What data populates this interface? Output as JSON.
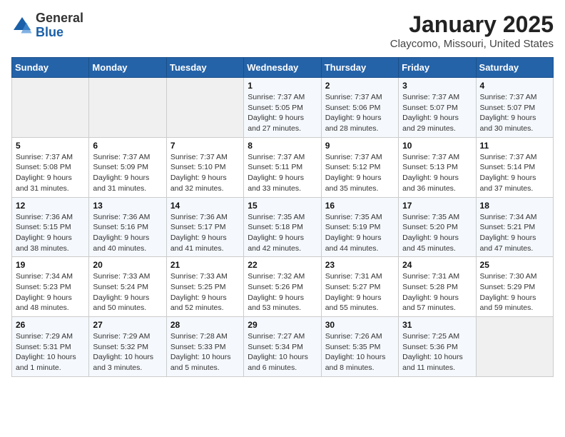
{
  "header": {
    "logo_general": "General",
    "logo_blue": "Blue",
    "title": "January 2025",
    "subtitle": "Claycomo, Missouri, United States"
  },
  "weekdays": [
    "Sunday",
    "Monday",
    "Tuesday",
    "Wednesday",
    "Thursday",
    "Friday",
    "Saturday"
  ],
  "weeks": [
    [
      {
        "day": "",
        "info": ""
      },
      {
        "day": "",
        "info": ""
      },
      {
        "day": "",
        "info": ""
      },
      {
        "day": "1",
        "info": "Sunrise: 7:37 AM\nSunset: 5:05 PM\nDaylight: 9 hours and 27 minutes."
      },
      {
        "day": "2",
        "info": "Sunrise: 7:37 AM\nSunset: 5:06 PM\nDaylight: 9 hours and 28 minutes."
      },
      {
        "day": "3",
        "info": "Sunrise: 7:37 AM\nSunset: 5:07 PM\nDaylight: 9 hours and 29 minutes."
      },
      {
        "day": "4",
        "info": "Sunrise: 7:37 AM\nSunset: 5:07 PM\nDaylight: 9 hours and 30 minutes."
      }
    ],
    [
      {
        "day": "5",
        "info": "Sunrise: 7:37 AM\nSunset: 5:08 PM\nDaylight: 9 hours and 31 minutes."
      },
      {
        "day": "6",
        "info": "Sunrise: 7:37 AM\nSunset: 5:09 PM\nDaylight: 9 hours and 31 minutes."
      },
      {
        "day": "7",
        "info": "Sunrise: 7:37 AM\nSunset: 5:10 PM\nDaylight: 9 hours and 32 minutes."
      },
      {
        "day": "8",
        "info": "Sunrise: 7:37 AM\nSunset: 5:11 PM\nDaylight: 9 hours and 33 minutes."
      },
      {
        "day": "9",
        "info": "Sunrise: 7:37 AM\nSunset: 5:12 PM\nDaylight: 9 hours and 35 minutes."
      },
      {
        "day": "10",
        "info": "Sunrise: 7:37 AM\nSunset: 5:13 PM\nDaylight: 9 hours and 36 minutes."
      },
      {
        "day": "11",
        "info": "Sunrise: 7:37 AM\nSunset: 5:14 PM\nDaylight: 9 hours and 37 minutes."
      }
    ],
    [
      {
        "day": "12",
        "info": "Sunrise: 7:36 AM\nSunset: 5:15 PM\nDaylight: 9 hours and 38 minutes."
      },
      {
        "day": "13",
        "info": "Sunrise: 7:36 AM\nSunset: 5:16 PM\nDaylight: 9 hours and 40 minutes."
      },
      {
        "day": "14",
        "info": "Sunrise: 7:36 AM\nSunset: 5:17 PM\nDaylight: 9 hours and 41 minutes."
      },
      {
        "day": "15",
        "info": "Sunrise: 7:35 AM\nSunset: 5:18 PM\nDaylight: 9 hours and 42 minutes."
      },
      {
        "day": "16",
        "info": "Sunrise: 7:35 AM\nSunset: 5:19 PM\nDaylight: 9 hours and 44 minutes."
      },
      {
        "day": "17",
        "info": "Sunrise: 7:35 AM\nSunset: 5:20 PM\nDaylight: 9 hours and 45 minutes."
      },
      {
        "day": "18",
        "info": "Sunrise: 7:34 AM\nSunset: 5:21 PM\nDaylight: 9 hours and 47 minutes."
      }
    ],
    [
      {
        "day": "19",
        "info": "Sunrise: 7:34 AM\nSunset: 5:23 PM\nDaylight: 9 hours and 48 minutes."
      },
      {
        "day": "20",
        "info": "Sunrise: 7:33 AM\nSunset: 5:24 PM\nDaylight: 9 hours and 50 minutes."
      },
      {
        "day": "21",
        "info": "Sunrise: 7:33 AM\nSunset: 5:25 PM\nDaylight: 9 hours and 52 minutes."
      },
      {
        "day": "22",
        "info": "Sunrise: 7:32 AM\nSunset: 5:26 PM\nDaylight: 9 hours and 53 minutes."
      },
      {
        "day": "23",
        "info": "Sunrise: 7:31 AM\nSunset: 5:27 PM\nDaylight: 9 hours and 55 minutes."
      },
      {
        "day": "24",
        "info": "Sunrise: 7:31 AM\nSunset: 5:28 PM\nDaylight: 9 hours and 57 minutes."
      },
      {
        "day": "25",
        "info": "Sunrise: 7:30 AM\nSunset: 5:29 PM\nDaylight: 9 hours and 59 minutes."
      }
    ],
    [
      {
        "day": "26",
        "info": "Sunrise: 7:29 AM\nSunset: 5:31 PM\nDaylight: 10 hours and 1 minute."
      },
      {
        "day": "27",
        "info": "Sunrise: 7:29 AM\nSunset: 5:32 PM\nDaylight: 10 hours and 3 minutes."
      },
      {
        "day": "28",
        "info": "Sunrise: 7:28 AM\nSunset: 5:33 PM\nDaylight: 10 hours and 5 minutes."
      },
      {
        "day": "29",
        "info": "Sunrise: 7:27 AM\nSunset: 5:34 PM\nDaylight: 10 hours and 6 minutes."
      },
      {
        "day": "30",
        "info": "Sunrise: 7:26 AM\nSunset: 5:35 PM\nDaylight: 10 hours and 8 minutes."
      },
      {
        "day": "31",
        "info": "Sunrise: 7:25 AM\nSunset: 5:36 PM\nDaylight: 10 hours and 11 minutes."
      },
      {
        "day": "",
        "info": ""
      }
    ]
  ]
}
